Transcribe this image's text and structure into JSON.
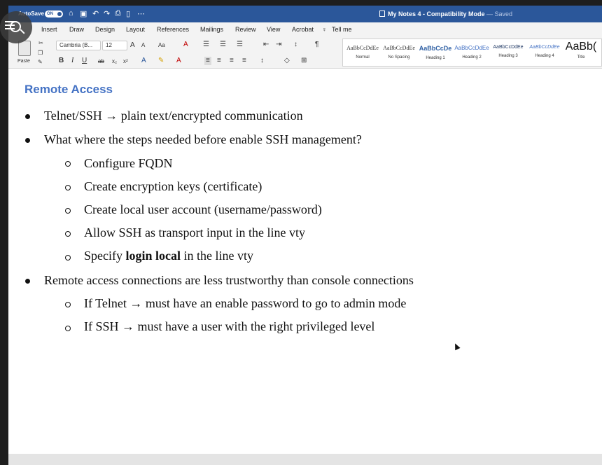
{
  "titlebar": {
    "autosave_label": "AutoSave",
    "autosave_state": "ON",
    "doc_name": "My Notes 4 - Compatibility Mode",
    "save_status": "— Saved",
    "bg_color": "#2b579a"
  },
  "tabs": [
    "Insert",
    "Draw",
    "Design",
    "Layout",
    "References",
    "Mailings",
    "Review",
    "View",
    "Acrobat",
    "Tell me"
  ],
  "ribbon": {
    "paste_label": "Paste",
    "font_name": "Cambria (B...",
    "font_size": "12",
    "styles": [
      {
        "preview": "AaBbCcDdEe",
        "name": "Normal"
      },
      {
        "preview": "AaBbCcDdEe",
        "name": "No Spacing"
      },
      {
        "preview": "AaBbCcDe",
        "name": "Heading 1"
      },
      {
        "preview": "AaBbCcDdEe",
        "name": "Heading 2"
      },
      {
        "preview": "AaBbCcDdEe",
        "name": "Heading 3"
      },
      {
        "preview": "AaBbCcDdEe",
        "name": "Heading 4"
      },
      {
        "preview": "AaBb(",
        "name": "Title"
      }
    ]
  },
  "document": {
    "heading": "Remote Access",
    "b1": {
      "text_before": "Telnet/SSH",
      "arrow": "→",
      "text_after": "plain text/encrypted communication"
    },
    "b2": {
      "text": "What where the steps needed before enable SSH management?"
    },
    "s1": "Configure FQDN",
    "s2": "Create encryption keys (certificate)",
    "s3": "Create local user account (username/password)",
    "s4": "Allow SSH as transport input in the line vty",
    "s5": {
      "before": "Specify ",
      "bold": "login local",
      "after": " in the line vty"
    },
    "b3": {
      "text": "Remote access connections are less trustworthy than console connections"
    },
    "s6": {
      "before": "If Telnet",
      "arrow": "→",
      "after": "must have an enable password to go to admin mode"
    },
    "s7": {
      "before": "If SSH",
      "arrow": "→",
      "after": "must have a user with the right privileged level"
    }
  }
}
